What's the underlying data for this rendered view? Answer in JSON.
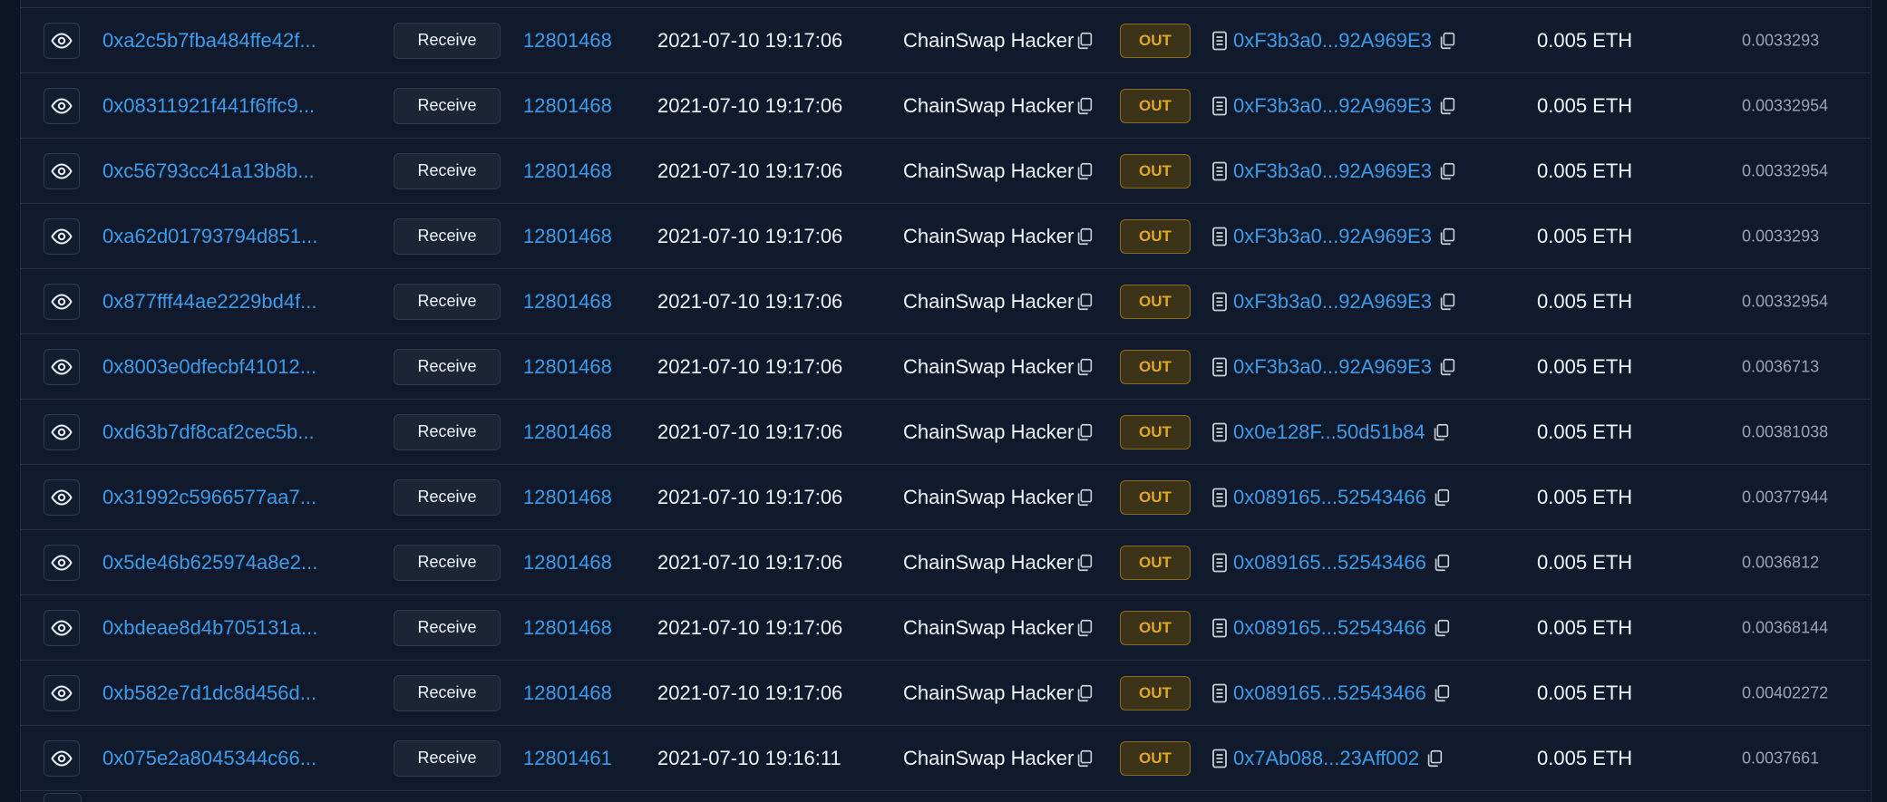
{
  "colors": {
    "background": "#0d1524",
    "panel": "#111a2c",
    "link": "#3d9be9",
    "out_badge_text": "#e0a72a",
    "out_badge_bg": "#3a3318",
    "fee_text": "#9aa3b2"
  },
  "icons": {
    "view": "eye-icon",
    "copy": "copy-icon",
    "contract": "document-icon"
  },
  "rows": [
    {
      "tx_hash": "0xa2c5b7fba484ffe42f...",
      "method": "Receive",
      "block": "12801468",
      "age": "2021-07-10 19:17:06",
      "from": "ChainSwap Hacker",
      "direction": "OUT",
      "to": "0xF3b3a0...92A969E3",
      "value": "0.005 ETH",
      "fee": "0.0033293"
    },
    {
      "tx_hash": "0x08311921f441f6ffc9...",
      "method": "Receive",
      "block": "12801468",
      "age": "2021-07-10 19:17:06",
      "from": "ChainSwap Hacker",
      "direction": "OUT",
      "to": "0xF3b3a0...92A969E3",
      "value": "0.005 ETH",
      "fee": "0.00332954"
    },
    {
      "tx_hash": "0xc56793cc41a13b8b...",
      "method": "Receive",
      "block": "12801468",
      "age": "2021-07-10 19:17:06",
      "from": "ChainSwap Hacker",
      "direction": "OUT",
      "to": "0xF3b3a0...92A969E3",
      "value": "0.005 ETH",
      "fee": "0.00332954"
    },
    {
      "tx_hash": "0xa62d01793794d851...",
      "method": "Receive",
      "block": "12801468",
      "age": "2021-07-10 19:17:06",
      "from": "ChainSwap Hacker",
      "direction": "OUT",
      "to": "0xF3b3a0...92A969E3",
      "value": "0.005 ETH",
      "fee": "0.0033293"
    },
    {
      "tx_hash": "0x877fff44ae2229bd4f...",
      "method": "Receive",
      "block": "12801468",
      "age": "2021-07-10 19:17:06",
      "from": "ChainSwap Hacker",
      "direction": "OUT",
      "to": "0xF3b3a0...92A969E3",
      "value": "0.005 ETH",
      "fee": "0.00332954"
    },
    {
      "tx_hash": "0x8003e0dfecbf41012...",
      "method": "Receive",
      "block": "12801468",
      "age": "2021-07-10 19:17:06",
      "from": "ChainSwap Hacker",
      "direction": "OUT",
      "to": "0xF3b3a0...92A969E3",
      "value": "0.005 ETH",
      "fee": "0.0036713"
    },
    {
      "tx_hash": "0xd63b7df8caf2cec5b...",
      "method": "Receive",
      "block": "12801468",
      "age": "2021-07-10 19:17:06",
      "from": "ChainSwap Hacker",
      "direction": "OUT",
      "to": "0x0e128F...50d51b84",
      "value": "0.005 ETH",
      "fee": "0.00381038"
    },
    {
      "tx_hash": "0x31992c5966577aa7...",
      "method": "Receive",
      "block": "12801468",
      "age": "2021-07-10 19:17:06",
      "from": "ChainSwap Hacker",
      "direction": "OUT",
      "to": "0x089165...52543466",
      "value": "0.005 ETH",
      "fee": "0.00377944"
    },
    {
      "tx_hash": "0x5de46b625974a8e2...",
      "method": "Receive",
      "block": "12801468",
      "age": "2021-07-10 19:17:06",
      "from": "ChainSwap Hacker",
      "direction": "OUT",
      "to": "0x089165...52543466",
      "value": "0.005 ETH",
      "fee": "0.0036812"
    },
    {
      "tx_hash": "0xbdeae8d4b705131a...",
      "method": "Receive",
      "block": "12801468",
      "age": "2021-07-10 19:17:06",
      "from": "ChainSwap Hacker",
      "direction": "OUT",
      "to": "0x089165...52543466",
      "value": "0.005 ETH",
      "fee": "0.00368144"
    },
    {
      "tx_hash": "0xb582e7d1dc8d456d...",
      "method": "Receive",
      "block": "12801468",
      "age": "2021-07-10 19:17:06",
      "from": "ChainSwap Hacker",
      "direction": "OUT",
      "to": "0x089165...52543466",
      "value": "0.005 ETH",
      "fee": "0.00402272"
    },
    {
      "tx_hash": "0x075e2a8045344c66...",
      "method": "Receive",
      "block": "12801461",
      "age": "2021-07-10 19:16:11",
      "from": "ChainSwap Hacker",
      "direction": "OUT",
      "to": "0x7Ab088...23Aff002",
      "value": "0.005 ETH",
      "fee": "0.0037661"
    }
  ]
}
